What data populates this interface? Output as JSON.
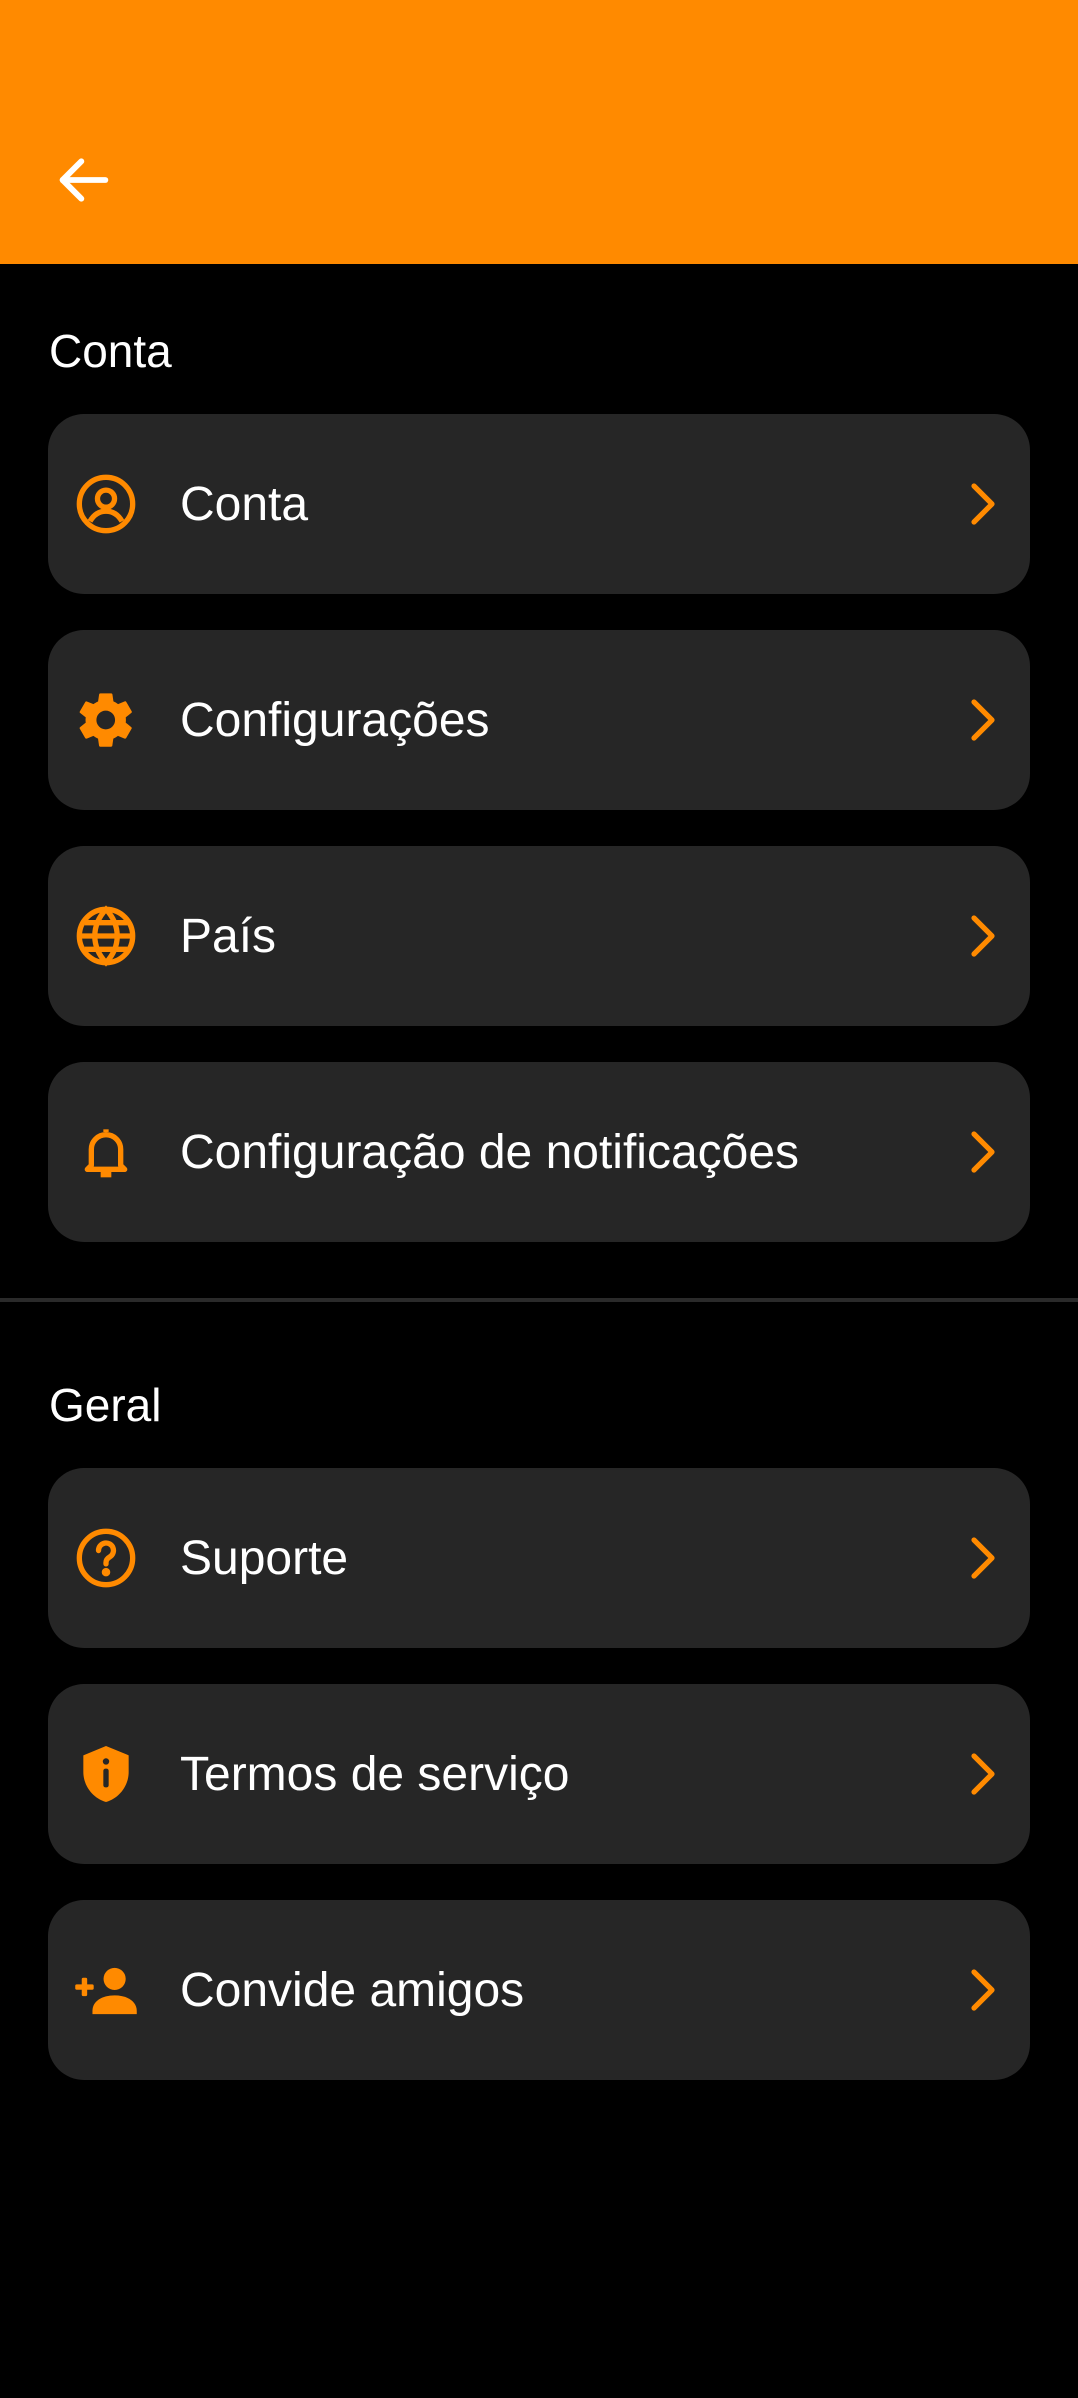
{
  "colors": {
    "accent": "#FF8A00",
    "card": "#262626",
    "background": "#000000"
  },
  "header": {
    "back_icon": "arrow-left-icon"
  },
  "sections": [
    {
      "title": "Conta",
      "items": [
        {
          "label": "Conta",
          "icon": "account-circle-icon"
        },
        {
          "label": "Configurações",
          "icon": "gear-icon"
        },
        {
          "label": "País",
          "icon": "globe-icon"
        },
        {
          "label": "Configuração de notificações",
          "icon": "bell-icon"
        }
      ]
    },
    {
      "title": "Geral",
      "items": [
        {
          "label": "Suporte",
          "icon": "help-circle-icon"
        },
        {
          "label": "Termos de serviço",
          "icon": "shield-info-icon"
        },
        {
          "label": "Convide amigos",
          "icon": "add-person-icon"
        }
      ]
    }
  ]
}
